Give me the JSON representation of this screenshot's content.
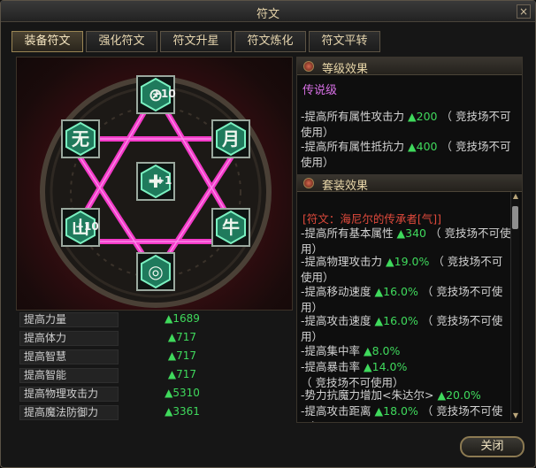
{
  "window": {
    "title": "符文",
    "close_glyph": "×"
  },
  "tabs": [
    {
      "label": "装备符文",
      "active": true
    },
    {
      "label": "强化符文",
      "active": false
    },
    {
      "label": "符文升星",
      "active": false
    },
    {
      "label": "符文炼化",
      "active": false
    },
    {
      "label": "符文平转",
      "active": false
    }
  ],
  "runes": [
    {
      "name": "rune-top",
      "glyph": "⊘",
      "level": "+10"
    },
    {
      "name": "rune-upper-left",
      "glyph": "无",
      "level": ""
    },
    {
      "name": "rune-upper-right",
      "glyph": "月",
      "level": ""
    },
    {
      "name": "rune-center",
      "glyph": "✚",
      "level": "+1"
    },
    {
      "name": "rune-lower-left",
      "glyph": "山",
      "level": "+10"
    },
    {
      "name": "rune-lower-right",
      "glyph": "牛",
      "level": ""
    },
    {
      "name": "rune-bottom",
      "glyph": "◎",
      "level": ""
    }
  ],
  "stats": [
    {
      "label": "提高力量",
      "value": "▲1689"
    },
    {
      "label": "提高体力",
      "value": "▲717"
    },
    {
      "label": "提高智慧",
      "value": "▲717"
    },
    {
      "label": "提高智能",
      "value": "▲717"
    },
    {
      "label": "提高物理攻击力",
      "value": "▲5310"
    },
    {
      "label": "提高魔法防御力",
      "value": "▲3361"
    }
  ],
  "grade_effect": {
    "header": "等级效果",
    "tier": "传说级",
    "lines": [
      {
        "text": "-提高所有属性攻击力",
        "value": "▲200",
        "note": "（ 竞技场不可使用）"
      },
      {
        "text": "-提高所有属性抵抗力",
        "value": "▲400",
        "note": "（ 竞技场不可使用）"
      }
    ]
  },
  "set_effect": {
    "header": "套装效果",
    "title": "[符文：海尼尔的传承者[气]]",
    "lines": [
      {
        "text": "-提高所有基本属性",
        "value": "▲340",
        "note": "（ 竞技场不可使用）"
      },
      {
        "text": "-提高物理攻击力",
        "value": "▲19.0%",
        "note": "（ 竞技场不可使用）"
      },
      {
        "text": "-提高移动速度",
        "value": "▲16.0%",
        "note": "（ 竞技场不可使用）"
      },
      {
        "text": "-提高攻击速度",
        "value": "▲16.0%",
        "note": "（ 竞技场不可使用）"
      },
      {
        "text": "-提高集中率",
        "value": "▲8.0%",
        "note": ""
      },
      {
        "text": "-提高暴击率",
        "value": "▲14.0%",
        "note": "（ 竞技场不可使用）"
      },
      {
        "text": "-势力抗魔力增加<朱达尔>",
        "value": "▲20.0%",
        "note": ""
      },
      {
        "text": "-提高攻击距离",
        "value": "▲18.0%",
        "note": "（ 竞技场不可使用）"
      }
    ]
  },
  "scrollbar": {
    "up_glyph": "▲",
    "down_glyph": "▼"
  },
  "footer": {
    "close_label": "关闭"
  },
  "colors": {
    "accent_green": "#3fd95c",
    "legendary_purple": "#d870e6",
    "set_title_red": "#e04a3c",
    "gold_text": "#e8d6a8",
    "pentagram_pink": "#ff3cd2"
  },
  "icons": {
    "section_head": "rune-orb-icon",
    "window_close": "close-icon"
  }
}
